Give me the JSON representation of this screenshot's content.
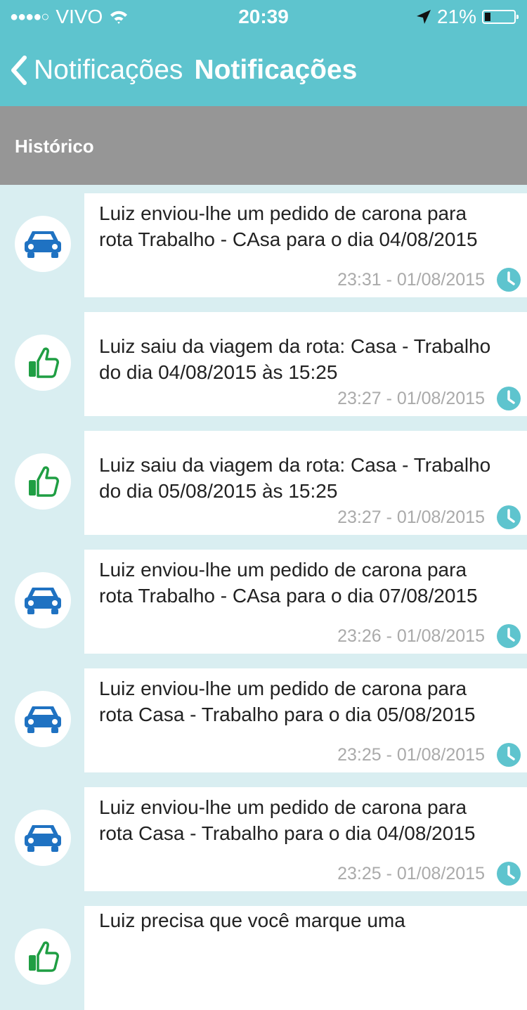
{
  "status_bar": {
    "carrier": "VIVO",
    "time": "20:39",
    "battery": "21%",
    "battery_level": 0.21
  },
  "nav": {
    "back_label": "Notificações",
    "title": "Notificações"
  },
  "section": {
    "title": "Histórico"
  },
  "notifications": [
    {
      "icon": "car-icon",
      "text": "Luiz enviou-lhe um pedido de carona para rota Trabalho - CAsa para o dia 04/08/2015",
      "timestamp": "23:31 - 01/08/2015"
    },
    {
      "icon": "thumbs-up-icon",
      "text": "Luiz saiu da viagem da rota:  Casa - Trabalho do dia 04/08/2015 às 15:25",
      "timestamp": "23:27 - 01/08/2015"
    },
    {
      "icon": "thumbs-up-icon",
      "text": "Luiz saiu da viagem da rota:  Casa - Trabalho do dia 05/08/2015 às 15:25",
      "timestamp": "23:27 - 01/08/2015"
    },
    {
      "icon": "car-icon",
      "text": "Luiz enviou-lhe um pedido de carona para rota Trabalho - CAsa para o dia 07/08/2015",
      "timestamp": "23:26 - 01/08/2015"
    },
    {
      "icon": "car-icon",
      "text": "Luiz enviou-lhe um pedido de carona para rota Casa - Trabalho para o dia 05/08/2015",
      "timestamp": "23:25 - 01/08/2015"
    },
    {
      "icon": "car-icon",
      "text": "Luiz enviou-lhe um pedido de carona para rota Casa - Trabalho para o dia 04/08/2015",
      "timestamp": "23:25 - 01/08/2015"
    },
    {
      "icon": "thumbs-up-icon",
      "text": "Luiz precisa que você marque uma",
      "timestamp": ""
    }
  ],
  "colors": {
    "header": "#5ec4ce",
    "section_header": "#969696",
    "list_background": "#d9eef1",
    "car_icon": "#1f72c2",
    "thumbs_up_icon": "#1f9e43",
    "clock_icon": "#5ec4ce"
  }
}
